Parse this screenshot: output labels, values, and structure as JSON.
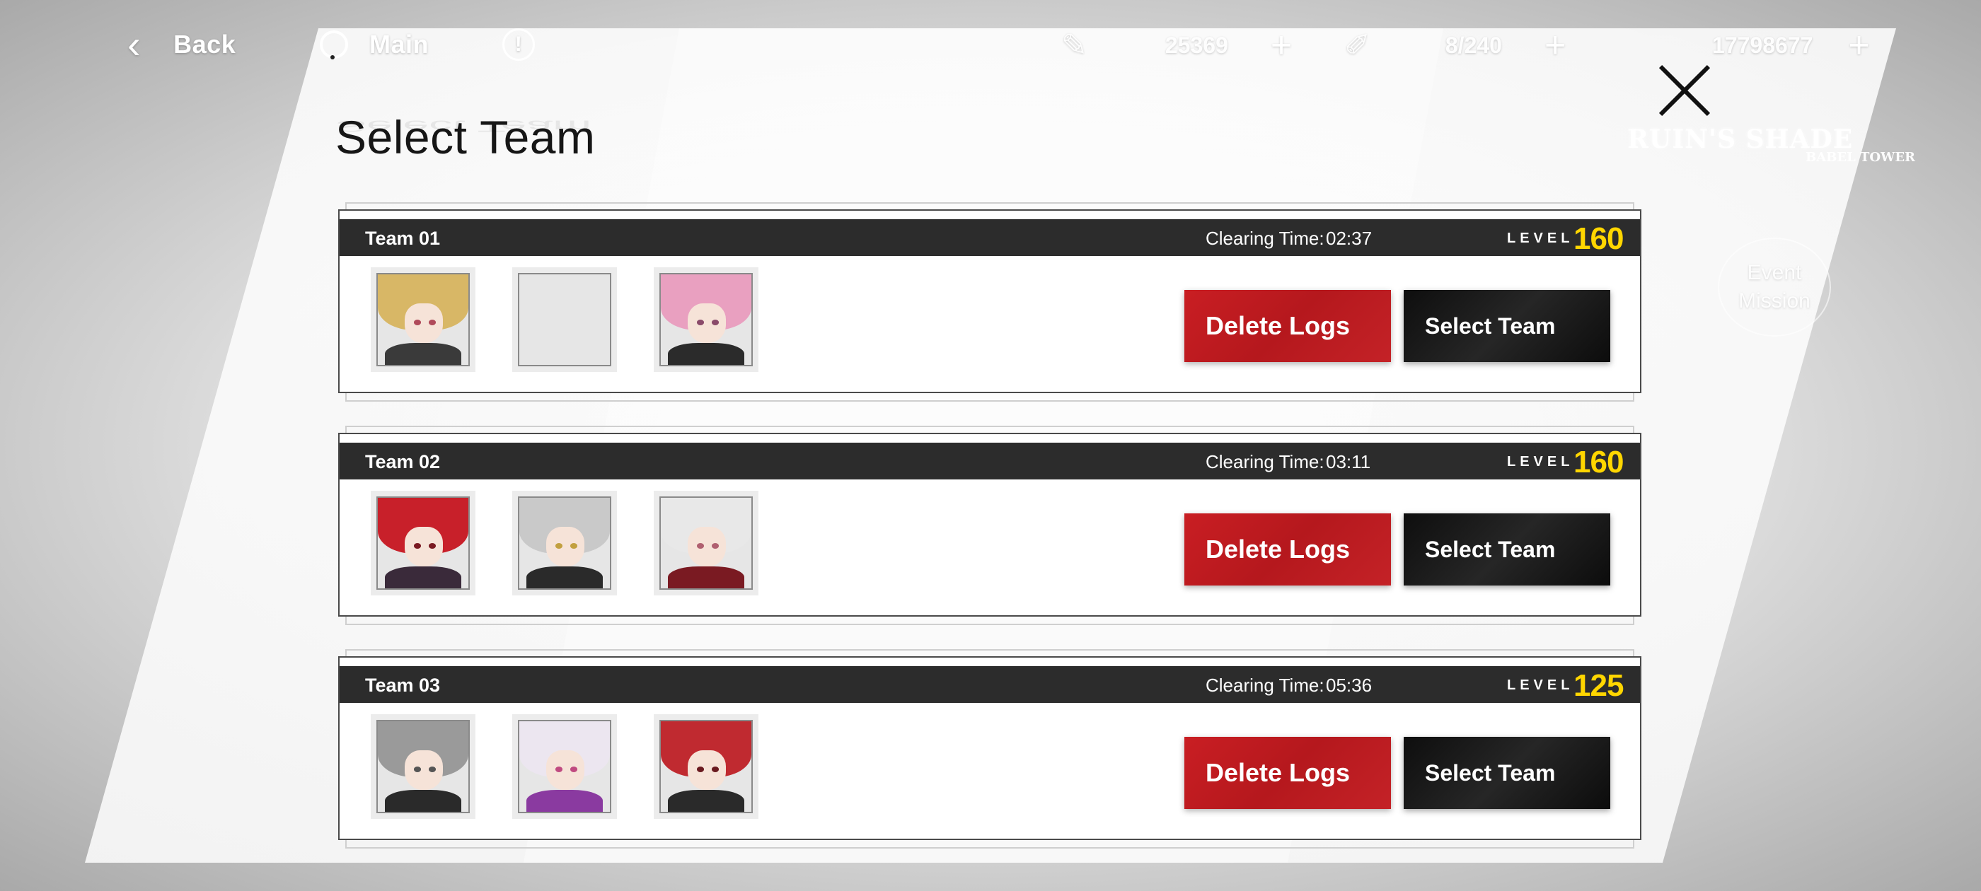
{
  "topbar": {
    "back_label": "Back",
    "main_label": "Main",
    "alert_glyph": "!",
    "resources": [
      {
        "icon": "pen-icon",
        "value": "25369",
        "plus": "+"
      },
      {
        "icon": "syringe-icon",
        "value": "8/240",
        "plus": "+"
      },
      {
        "icon": "coin-icon",
        "value": "17798677",
        "plus": "+"
      }
    ]
  },
  "brand": {
    "title": "RUIN'S SHADE",
    "subtitle": "BABEL TOWER"
  },
  "event": {
    "line1": "Event",
    "line2": "Mission"
  },
  "page_title": "Select Team",
  "teams": [
    {
      "name": "Team 01",
      "clearing_label": "Clearing Time:",
      "clearing_time": "02:37",
      "level_label": "LEVEL",
      "level": "160",
      "delete_label": "Delete Logs",
      "select_label": "Select Team",
      "members": [
        {
          "hair": "#d8b766",
          "body": "#3a3a3a",
          "eye": "#b04a5a",
          "empty": false
        },
        {
          "empty": true
        },
        {
          "hair": "#e9a0c0",
          "body": "#2b2b2b",
          "eye": "#8a4a6a",
          "empty": false
        }
      ]
    },
    {
      "name": "Team 02",
      "clearing_label": "Clearing Time:",
      "clearing_time": "03:11",
      "level_label": "LEVEL",
      "level": "160",
      "delete_label": "Delete Logs",
      "select_label": "Select Team",
      "members": [
        {
          "hair": "#c8202a",
          "body": "#3a2a3a",
          "eye": "#7a1a22",
          "empty": false
        },
        {
          "hair": "#c9c9c9",
          "body": "#2a2a2a",
          "eye": "#c2a040",
          "empty": false
        },
        {
          "hair": "#e8e8e8",
          "body": "#7a1a22",
          "eye": "#b06070",
          "empty": false
        }
      ]
    },
    {
      "name": "Team 03",
      "clearing_label": "Clearing Time:",
      "clearing_time": "05:36",
      "level_label": "LEVEL",
      "level": "125",
      "delete_label": "Delete Logs",
      "select_label": "Select Team",
      "members": [
        {
          "hair": "#9a9a9a",
          "body": "#2a2a2a",
          "eye": "#555555",
          "empty": false
        },
        {
          "hair": "#ece6f0",
          "body": "#8a3aa0",
          "eye": "#c04a80",
          "empty": false
        },
        {
          "hair": "#c02a30",
          "body": "#2a2a2a",
          "eye": "#6a1a20",
          "empty": false
        }
      ]
    }
  ]
}
